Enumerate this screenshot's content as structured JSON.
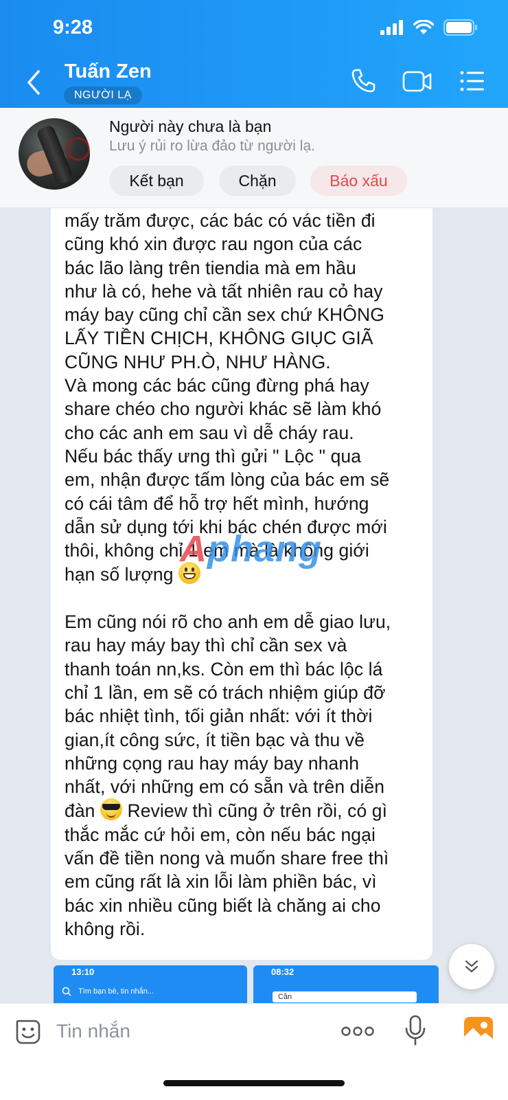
{
  "status_bar": {
    "time": "9:28"
  },
  "header": {
    "contact_name": "Tuấn Zen",
    "stranger_badge": "NGƯỜI LẠ",
    "icons": [
      "back-icon",
      "phone-icon",
      "video-call-icon",
      "menu-list-icon"
    ]
  },
  "banner": {
    "title": "Người này chưa là bạn",
    "subtitle": "Lưu ý rủi ro lừa đảo từ người lạ.",
    "add_friend_label": "Kết bạn",
    "block_label": "Chặn",
    "report_label": "Báo xấu"
  },
  "message": {
    "lines": [
      "mấy trăm được, các bác có vác tiền đi",
      "cũng khó xin được rau ngon của các",
      "bác lão làng trên tiendia mà em hầu",
      "như là có, hehe và tất nhiên rau cỏ hay",
      "máy bay cũng chỉ cần sex  chứ KHÔNG",
      "LẤY TIỀN CHỊCH, KHÔNG GIỤC GIÃ",
      "CŨNG NHƯ PH.Ò, NHƯ HÀNG.",
      "Và mong các bác cũng đừng phá hay",
      "share chéo cho người khác sẽ làm khó",
      "cho các anh em sau vì dễ cháy rau.",
      "Nếu bác thấy ưng thì gửi \" Lộc \" qua",
      "em, nhận được tấm lòng của bác em sẽ",
      "có cái tâm để hỗ trợ hết mình, hướng",
      "dẫn sử dụng tới khi bác chén được mới",
      "thôi, không chỉ 1 em mà là không giới"
    ],
    "line_with_emoji_1": "hạn số lượng",
    "lines_2": [
      "Em cũng nói rõ cho anh em dễ giao lưu,",
      "rau hay máy bay thì chỉ cần sex và",
      "thanh toán nn,ks. Còn em thì bác lộc lá",
      "chỉ 1 lần, em sẽ có trách nhiệm giúp đỡ",
      "bác nhiệt tình, tối giản nhất: với ít thời",
      "gian,ít công sức, ít tiền bạc và thu về",
      "những cọng rau hay máy bay nhanh",
      "nhất, với những em có sẵn và trên diễn"
    ],
    "line_with_emoji_2_prefix": "đàn",
    "line_with_emoji_2_suffix": "Review thì cũng ở trên rồi, có gì",
    "lines_3": [
      "thắc mắc cứ hỏi em, còn nếu bác ngại",
      "vấn đề tiền nong và muốn share free thì",
      "em cũng rất là xin lỗi làm phiền bác, vì",
      "bác xin nhiều cũng biết là chăng ai cho",
      "không rồi."
    ],
    "emoji_1": "grinning-face-emoji",
    "emoji_2": "sunglasses-face-emoji"
  },
  "watermark": {
    "part1": "A",
    "part2": "phang"
  },
  "thumbnails": [
    {
      "time": "13:10",
      "search_text": "Tìm bạn bè, tin nhắn..."
    },
    {
      "time": "08:32",
      "search_text": "Cần"
    }
  ],
  "input": {
    "placeholder": "Tin nhắn"
  },
  "colors": {
    "header_blue": "#1f9af7",
    "report_red": "#e8474a"
  }
}
